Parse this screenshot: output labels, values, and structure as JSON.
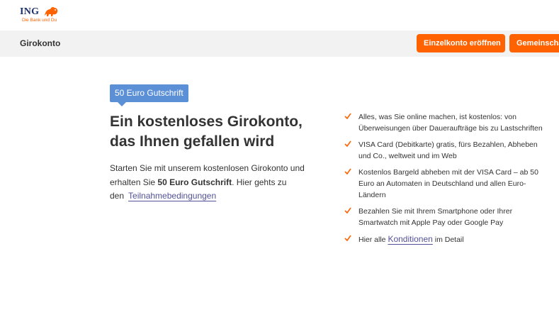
{
  "brand": {
    "name": "ING",
    "tagline": "Die Bank und Du",
    "accent": "#ff6200",
    "navy": "#1b2f6b",
    "badge_color": "#5b8fd6",
    "link_color": "#525199"
  },
  "subnav": {
    "title": "Girokonto",
    "buttons": [
      "Einzelkonto eröffnen",
      "Gemeinscha"
    ]
  },
  "hero": {
    "badge": "50 Euro Gutschrift",
    "headline": "Ein kostenloses Girokonto, das Ihnen gefallen wird",
    "intro_part1": "Starten Sie mit unserem kostenlosen Girokonto und erhalten Sie ",
    "intro_bold": "50 Euro Gutschrift",
    "intro_part2": ". Hier gehts zu den",
    "intro_link": "Teilnahmebedingungen"
  },
  "features": [
    "Alles, was Sie online machen, ist kostenlos: von Überweisungen über Daueraufträge bis zu Lastschriften",
    "VISA Card (Debitkarte) gratis, fürs Bezahlen, Abheben und Co., weltweit und im Web",
    "Kostenlos Bargeld abheben mit der VISA Card – ab 50 Euro an Automaten in Deutschland und allen Euro-Ländern",
    "Bezahlen Sie mit Ihrem Smartphone oder Ihrer Smartwatch mit Apple Pay oder Google Pay"
  ],
  "conditions": {
    "prefix": "Hier alle",
    "link": "Konditionen",
    "suffix": "im Detail"
  },
  "icons": {
    "logo": "lion-logo-icon",
    "check": "checkmark-icon"
  }
}
